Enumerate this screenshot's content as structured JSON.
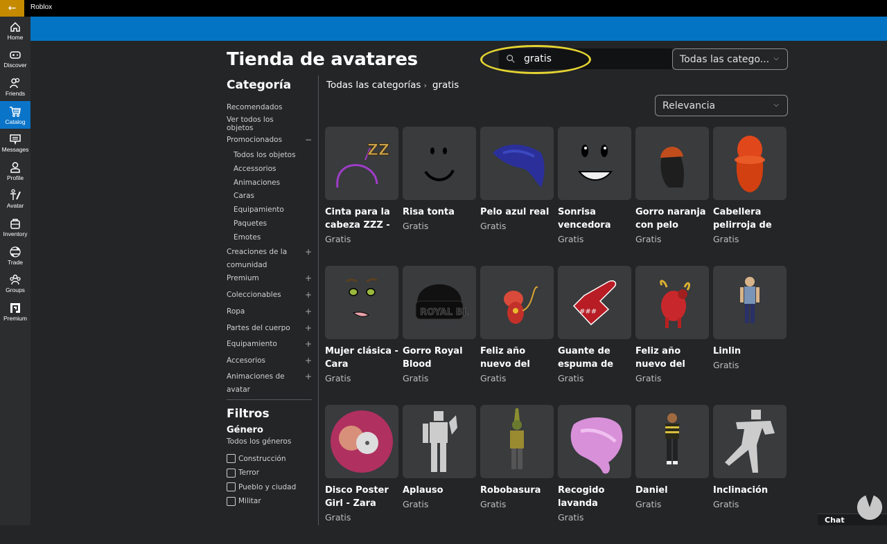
{
  "window": {
    "title": "Roblox",
    "back_label": "←"
  },
  "sidenav": [
    {
      "label": "Home",
      "icon": "home-icon",
      "active": false
    },
    {
      "label": "Discover",
      "icon": "gamepad-icon",
      "active": false
    },
    {
      "label": "Friends",
      "icon": "friends-icon",
      "active": false
    },
    {
      "label": "Catalog",
      "icon": "cart-icon",
      "active": true
    },
    {
      "label": "Messages",
      "icon": "message-icon",
      "active": false
    },
    {
      "label": "Profile",
      "icon": "profile-icon",
      "active": false
    },
    {
      "label": "Avatar",
      "icon": "avatar-icon",
      "active": false
    },
    {
      "label": "Inventory",
      "icon": "backpack-icon",
      "active": false
    },
    {
      "label": "Trade",
      "icon": "trade-icon",
      "active": false
    },
    {
      "label": "Groups",
      "icon": "groups-icon",
      "active": false
    },
    {
      "label": "Premium",
      "icon": "premium-icon",
      "active": false
    }
  ],
  "header": {
    "title": "Tienda de avatares",
    "search_value": "gratis",
    "category_select": "Todas las catego...",
    "sort_select": "Relevancia"
  },
  "breadcrumb": {
    "root": "Todas las categorías",
    "separator": "›",
    "current": "gratis"
  },
  "sidebar": {
    "heading": "Categoría",
    "items": [
      {
        "label": "Recomendados",
        "type": "top"
      },
      {
        "label": "Ver todos los objetos",
        "type": "top"
      },
      {
        "label": "Promocionados",
        "type": "group",
        "sign": "−"
      },
      {
        "label": "Todos los objetos",
        "type": "sub"
      },
      {
        "label": "Accessorios",
        "type": "sub"
      },
      {
        "label": "Animaciones",
        "type": "sub"
      },
      {
        "label": "Caras",
        "type": "sub"
      },
      {
        "label": "Equipamiento",
        "type": "sub"
      },
      {
        "label": "Paquetes",
        "type": "sub"
      },
      {
        "label": "Emotes",
        "type": "sub"
      },
      {
        "label": "Creaciones de la comunidad",
        "type": "group2",
        "sign": "+"
      },
      {
        "label": "Premium",
        "type": "group",
        "sign": "+"
      },
      {
        "label": "Coleccionables",
        "type": "group",
        "sign": "+"
      },
      {
        "label": "Ropa",
        "type": "group",
        "sign": "+"
      },
      {
        "label": "Partes del cuerpo",
        "type": "group",
        "sign": "+"
      },
      {
        "label": "Equipamiento",
        "type": "group",
        "sign": "+"
      },
      {
        "label": "Accesorios",
        "type": "group",
        "sign": "+"
      },
      {
        "label": "Animaciones de avatar",
        "type": "group2",
        "sign": "+"
      }
    ]
  },
  "filters": {
    "heading": "Filtros",
    "genre_heading": "Género",
    "genre_all": "Todos los géneros",
    "genres": [
      {
        "label": "Construcción",
        "checked": false
      },
      {
        "label": "Terror",
        "checked": false
      },
      {
        "label": "Pueblo y ciudad",
        "checked": false
      },
      {
        "label": "Militar",
        "checked": false
      }
    ]
  },
  "items": [
    {
      "name": "Cinta para la cabeza ZZZ -",
      "price": "Gratis",
      "thumb": "headband"
    },
    {
      "name": "Risa tonta",
      "price": "Gratis",
      "thumb": "face-simple"
    },
    {
      "name": "Pelo azul real",
      "price": "Gratis",
      "thumb": "hair-blue"
    },
    {
      "name": "Sonrisa vencedora",
      "price": "Gratis",
      "thumb": "face-smile"
    },
    {
      "name": "Gorro naranja con pelo",
      "price": "Gratis",
      "thumb": "beanie-orange"
    },
    {
      "name": "Cabellera pelirroja de",
      "price": "Gratis",
      "thumb": "hair-red"
    },
    {
      "name": "Mujer clásica - Cara",
      "price": "Gratis",
      "thumb": "face-woman"
    },
    {
      "name": "Gorro Royal Blood",
      "price": "Gratis",
      "thumb": "beanie-black"
    },
    {
      "name": "Feliz año nuevo del",
      "price": "Gratis",
      "thumb": "rat"
    },
    {
      "name": "Guante de espuma de fan",
      "price": "Gratis",
      "thumb": "foam-finger"
    },
    {
      "name": "Feliz año nuevo del",
      "price": "Gratis",
      "thumb": "ox"
    },
    {
      "name": "Linlin",
      "price": "Gratis",
      "thumb": "avatar-girl"
    },
    {
      "name": "Disco Poster Girl - Zara",
      "price": "Gratis",
      "thumb": "disc"
    },
    {
      "name": "Aplauso",
      "price": "Gratis",
      "thumb": "emote-clap"
    },
    {
      "name": "Robobasura",
      "price": "Gratis",
      "thumb": "robot"
    },
    {
      "name": "Recogido lavanda",
      "price": "Gratis",
      "thumb": "hair-lavender"
    },
    {
      "name": "Daniel",
      "price": "Gratis",
      "thumb": "avatar-boy"
    },
    {
      "name": "Inclinación",
      "price": "Gratis",
      "thumb": "emote-lean"
    }
  ],
  "chat": {
    "label": "Chat"
  },
  "colors": {
    "accent": "#0374c4",
    "active_nav": "#0a74c8",
    "back_button": "#c58a00",
    "highlight": "#e5d431"
  }
}
